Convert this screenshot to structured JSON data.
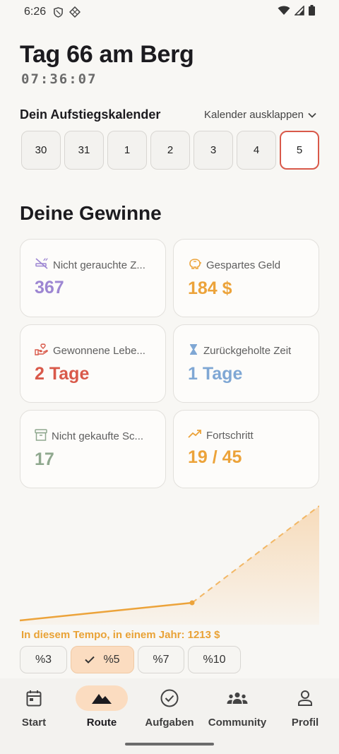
{
  "status": {
    "time": "6:26"
  },
  "header": {
    "title": "Tag 66 am Berg",
    "timer": "07:36:07"
  },
  "calendar": {
    "title": "Dein Aufstiegskalender",
    "expand_label": "Kalender ausklappen",
    "days": [
      "30",
      "31",
      "1",
      "2",
      "3",
      "4",
      "5"
    ],
    "selected_day": "5"
  },
  "gains": {
    "title": "Deine Gewinne",
    "cards": [
      {
        "label": "Nicht gerauchte Z...",
        "value": "367",
        "color": "#9d86d2",
        "icon": "no-smoking-icon"
      },
      {
        "label": "Gespartes Geld",
        "value": "184 $",
        "color": "#eca33a",
        "icon": "piggy-bank-icon"
      },
      {
        "label": "Gewonnene Lebe...",
        "value": "2 Tage",
        "color": "#d9594a",
        "icon": "hand-heart-icon"
      },
      {
        "label": "Zurückgeholte Zeit",
        "value": "1 Tage",
        "color": "#7fa7d4",
        "icon": "hourglass-icon"
      },
      {
        "label": "Nicht gekaufte Sc...",
        "value": "17",
        "color": "#8fa88e",
        "icon": "archive-box-icon"
      },
      {
        "label": "Fortschritt",
        "value": "19 / 45",
        "color": "#eca33a",
        "icon": "trending-up-icon"
      }
    ]
  },
  "projection": {
    "text": "In diesem Tempo, in einem Jahr:  1213 $"
  },
  "rate_options": [
    "%3",
    "%5",
    "%7",
    "%10"
  ],
  "rate_selected": "%5",
  "nav": {
    "items": [
      {
        "label": "Start",
        "icon": "calendar-icon"
      },
      {
        "label": "Route",
        "icon": "mountain-icon"
      },
      {
        "label": "Aufgaben",
        "icon": "check-circle-icon"
      },
      {
        "label": "Community",
        "icon": "group-icon"
      },
      {
        "label": "Profil",
        "icon": "person-icon"
      }
    ],
    "active": "Route"
  },
  "colors": {
    "accent": "#eca33a",
    "selected_border": "#d9594a",
    "active_bg": "#fbdcc0"
  }
}
